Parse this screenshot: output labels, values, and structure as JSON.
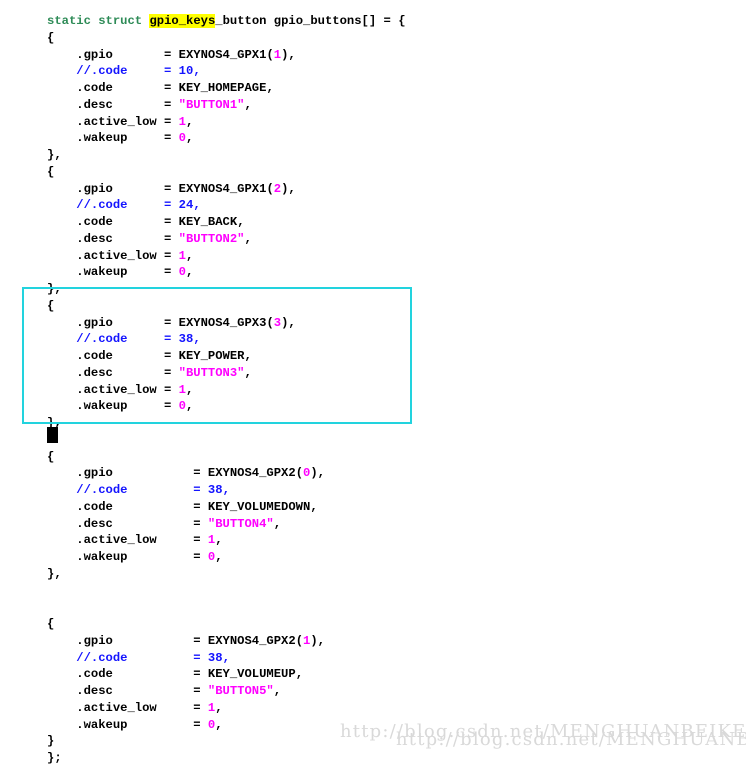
{
  "editor": {
    "language": "c",
    "background_color": "#FFFFFF",
    "default_text_color": "#000000",
    "keyword_color": "#2E8B57",
    "comment_color": "#1414FF",
    "string_color": "#FF00FF",
    "number_color": "#FF00FF",
    "search_highlight_color": "#FFFF00",
    "search_highlight_term": "gpio_keys",
    "annotation_rect_color": "#22D3DE",
    "cursor_color": "#000000"
  },
  "code": {
    "lines": [
      "static struct gpio_keys_button gpio_buttons[] = {",
      "{",
      "    .gpio       = EXYNOS4_GPX1(1),",
      "    //.code     = 10,",
      "    .code       = KEY_HOMEPAGE,",
      "    .desc       = \"BUTTON1\",",
      "    .active_low = 1,",
      "    .wakeup     = 0,",
      "},",
      "{",
      "    .gpio       = EXYNOS4_GPX1(2),",
      "    //.code     = 24,",
      "    .code       = KEY_BACK,",
      "    .desc       = \"BUTTON2\",",
      "    .active_low = 1,",
      "    .wakeup     = 0,",
      "},",
      "{",
      "    .gpio       = EXYNOS4_GPX3(3),",
      "    //.code     = 38,",
      "    .code       = KEY_POWER,",
      "    .desc       = \"BUTTON3\",",
      "    .active_low = 1,",
      "    .wakeup     = 0,",
      "},",
      "",
      "{",
      "    .gpio           = EXYNOS4_GPX2(0),",
      "    //.code         = 38,",
      "    .code           = KEY_VOLUMEDOWN,",
      "    .desc           = \"BUTTON4\",",
      "    .active_low     = 1,",
      "    .wakeup         = 0,",
      "},",
      "",
      "{",
      "    .gpio           = EXYNOS4_GPX2(1),",
      "    //.code         = 38,",
      "    .code           = KEY_VOLUMEUP,",
      "    .desc           = \"BUTTON5\",",
      "    .active_low     = 1,",
      "    .wakeup         = 0,",
      "}",
      "};"
    ],
    "declaration": {
      "keyword_static": "static",
      "keyword_struct": "struct",
      "highlighted_type": "gpio_keys",
      "type_suffix": "_button",
      "array_name": "gpio_buttons[]",
      "assign": "=",
      "open_brace": "{"
    },
    "blocks": [
      {
        "index": 1,
        "gpio": "EXYNOS4_GPX1(1)",
        "gpio_port": "EXYNOS4_GPX1",
        "gpio_pin": "1",
        "commented_code": "10",
        "code": "KEY_HOMEPAGE",
        "desc": "\"BUTTON1\"",
        "active_low": "1",
        "wakeup": "0",
        "highlighted": false
      },
      {
        "index": 2,
        "gpio": "EXYNOS4_GPX1(2)",
        "gpio_port": "EXYNOS4_GPX1",
        "gpio_pin": "2",
        "commented_code": "24",
        "code": "KEY_BACK",
        "desc": "\"BUTTON2\"",
        "active_low": "1",
        "wakeup": "0",
        "highlighted": false
      },
      {
        "index": 3,
        "gpio": "EXYNOS4_GPX3(3)",
        "gpio_port": "EXYNOS4_GPX3",
        "gpio_pin": "3",
        "commented_code": "38",
        "code": "KEY_POWER",
        "desc": "\"BUTTON3\"",
        "active_low": "1",
        "wakeup": "0",
        "highlighted": true
      },
      {
        "index": 4,
        "gpio": "EXYNOS4_GPX2(0)",
        "gpio_port": "EXYNOS4_GPX2",
        "gpio_pin": "0",
        "commented_code": "38",
        "code": "KEY_VOLUMEDOWN",
        "desc": "\"BUTTON4\"",
        "active_low": "1",
        "wakeup": "0",
        "highlighted": false
      },
      {
        "index": 5,
        "gpio": "EXYNOS4_GPX2(1)",
        "gpio_port": "EXYNOS4_GPX2",
        "gpio_pin": "1",
        "commented_code": "38",
        "code": "KEY_VOLUMEUP",
        "desc": "\"BUTTON5\"",
        "active_low": "1",
        "wakeup": "0",
        "highlighted": false
      }
    ],
    "field_names": {
      "gpio": ".gpio",
      "commented_code": "//.code",
      "code": ".code",
      "desc": ".desc",
      "active_low": ".active_low",
      "wakeup": ".wakeup"
    }
  },
  "watermark": {
    "line_a": "http://blog.csdn.net/MENGHUANBEIKE",
    "line_b": "http://blog.csdn.net/MENGHUANBEIKE"
  }
}
